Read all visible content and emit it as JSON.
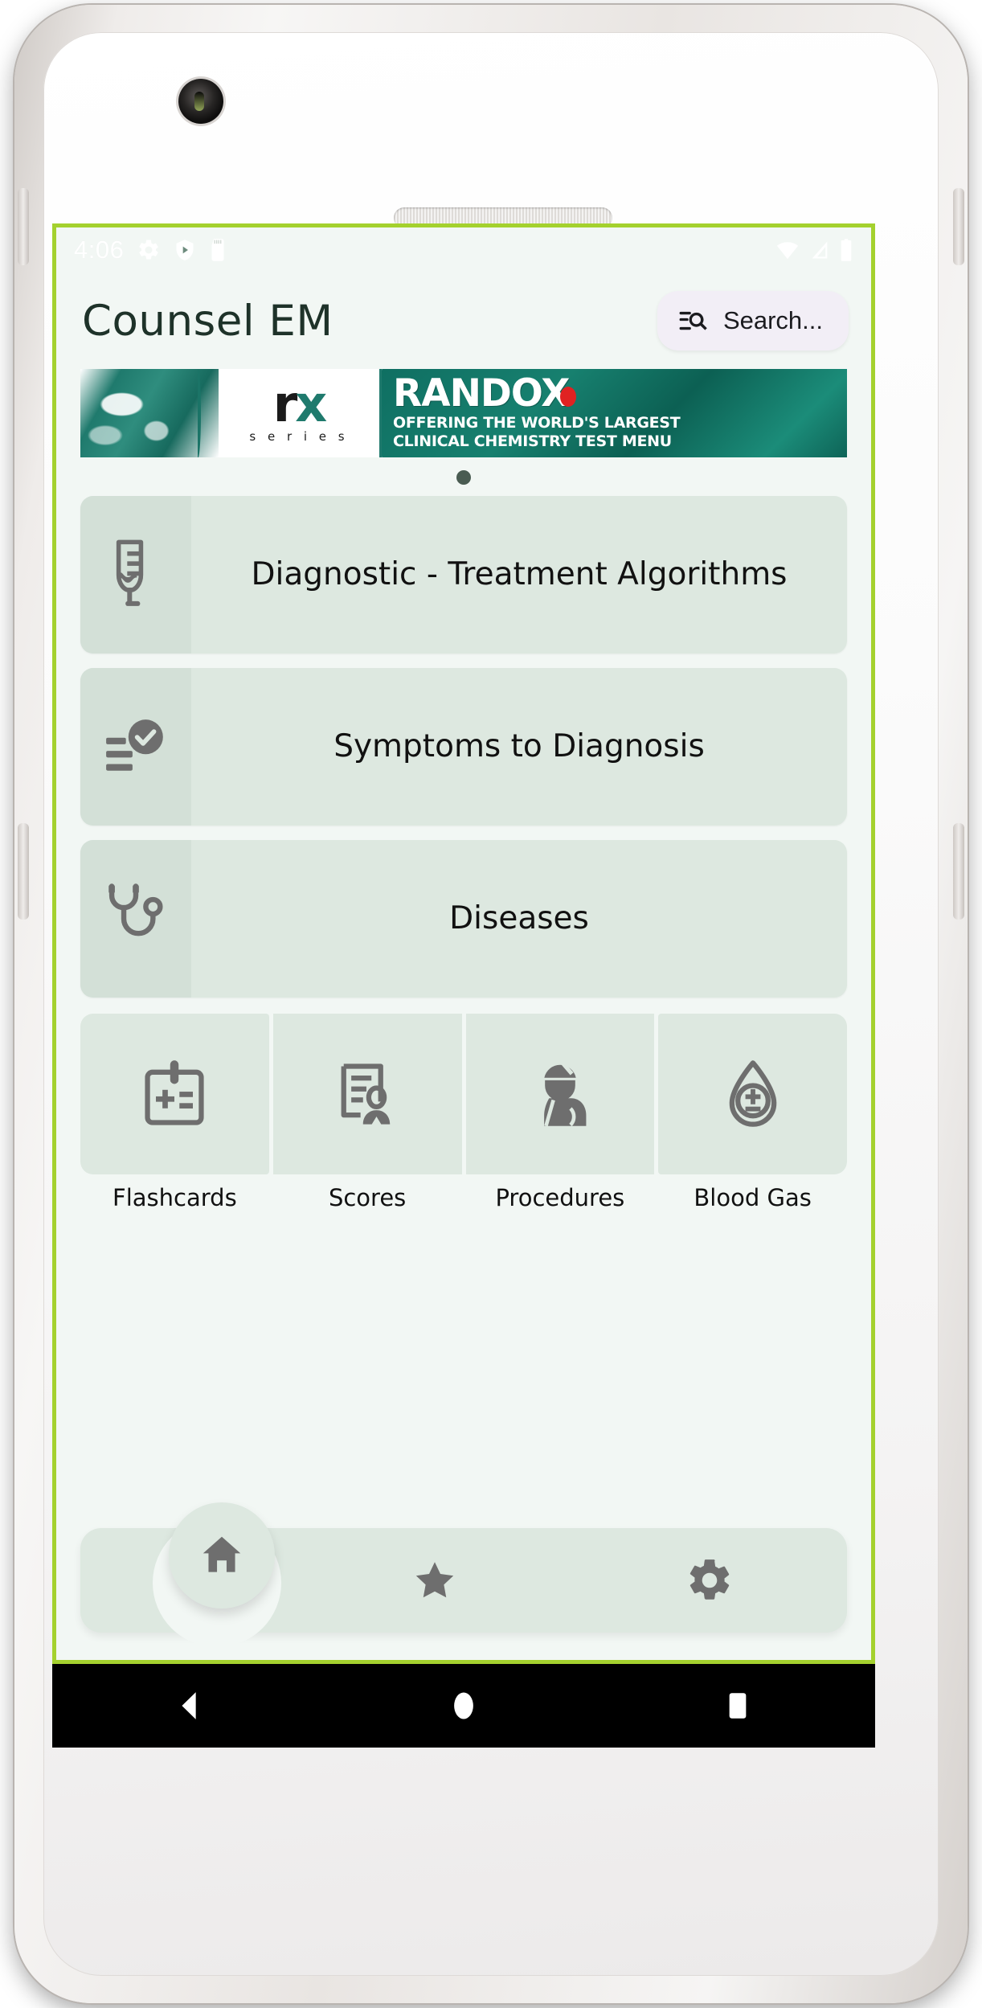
{
  "device": {
    "front_camera": "front-camera",
    "earpiece": "earpiece-speaker",
    "sensor": "proximity-sensor"
  },
  "status_bar": {
    "time": "4:06",
    "left_icons": [
      "gear-icon",
      "play-protect-icon",
      "sd-card-icon"
    ],
    "right_icons": [
      "wifi-icon",
      "cellular-signal-icon",
      "battery-icon"
    ]
  },
  "app_bar": {
    "title": "Counsel EM",
    "search": {
      "label": "Search...",
      "icon": "manage-search-icon"
    }
  },
  "ad_banner": {
    "rx_logo_r": "r",
    "rx_logo_x": "x",
    "rx_series": "s e r i e s",
    "brand": "RANDOX",
    "tagline_line1": "OFFERING THE WORLD'S LARGEST",
    "tagline_line2": "CLINICAL CHEMISTRY TEST MENU"
  },
  "carousel": {
    "dots": 1,
    "active_index": 0
  },
  "main_cards": [
    {
      "label": "Diagnostic - Treatment Algorithms",
      "icon": "iv-bag-icon"
    },
    {
      "label": "Symptoms to Diagnosis",
      "icon": "checklist-check-icon"
    },
    {
      "label": "Diseases",
      "icon": "stethoscope-icon"
    }
  ],
  "quick_grid": [
    {
      "label": "Flashcards",
      "icon": "flashcard-badge-icon"
    },
    {
      "label": "Scores",
      "icon": "scorecard-person-icon"
    },
    {
      "label": "Procedures",
      "icon": "surgeon-icon"
    },
    {
      "label": "Blood Gas",
      "icon": "blood-drop-plus-minus-icon"
    }
  ],
  "bottom_nav": [
    {
      "name": "home",
      "icon": "home-icon",
      "active": true
    },
    {
      "name": "favorites",
      "icon": "star-icon",
      "active": false
    },
    {
      "name": "settings",
      "icon": "gear-icon",
      "active": false
    }
  ],
  "system_nav": [
    {
      "name": "back",
      "icon": "back-triangle-icon"
    },
    {
      "name": "home",
      "icon": "home-circle-icon"
    },
    {
      "name": "recents",
      "icon": "recents-square-icon"
    }
  ],
  "colors": {
    "screen_border": "#a4d12e",
    "screen_bg": "#f2f7f4",
    "card_bg": "#dde8e0",
    "card_icon_strip": "#d3e0d7",
    "icon_gray": "#6e6e6e",
    "title_green": "#1e3229",
    "dot_indicator": "#4a5c52",
    "search_pill_bg": "#f2eef6",
    "ad_teal": "#1f7a6d",
    "ad_red_dot": "#e02222"
  }
}
